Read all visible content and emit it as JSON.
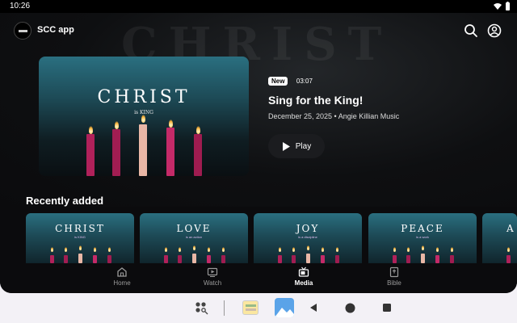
{
  "status_bar": {
    "time": "10:26",
    "icons": [
      "wifi-icon",
      "battery-icon"
    ]
  },
  "app_bar": {
    "title": "SCC app",
    "actions": [
      "search-icon",
      "account-icon"
    ]
  },
  "hero": {
    "background_word": "CHRIST",
    "art_title": "CHRIST",
    "art_subtitle": "is KING",
    "badge": "New",
    "duration": "03:07",
    "title": "Sing for the King!",
    "subtitle": "December 25, 2025 • Angie Killian Music",
    "play_label": "Play"
  },
  "recently_added": {
    "title": "Recently added",
    "items": [
      {
        "title": "CHRIST",
        "subtitle": "is KING"
      },
      {
        "title": "LOVE",
        "subtitle": "is an action"
      },
      {
        "title": "JOY",
        "subtitle": "is a discipline"
      },
      {
        "title": "PEACE",
        "subtitle": "is a work"
      },
      {
        "title": "A",
        "subtitle": ""
      }
    ]
  },
  "bottom_nav": {
    "items": [
      {
        "label": "Home",
        "icon": "home-icon",
        "active": false
      },
      {
        "label": "Watch",
        "icon": "play-screen-icon",
        "active": false
      },
      {
        "label": "Media",
        "icon": "tv-icon",
        "active": true
      },
      {
        "label": "Bible",
        "icon": "book-icon",
        "active": false
      }
    ]
  },
  "system_nav": {
    "icons": [
      "app-drawer-icon",
      "gallery-app-icon",
      "photos-app-icon",
      "back-icon",
      "home-circle-icon",
      "recents-icon"
    ]
  },
  "colors": {
    "app_bg": "#0b0b0d",
    "accent_teal": "#2a6f80",
    "system_bar_bg": "#f3f1f6"
  }
}
